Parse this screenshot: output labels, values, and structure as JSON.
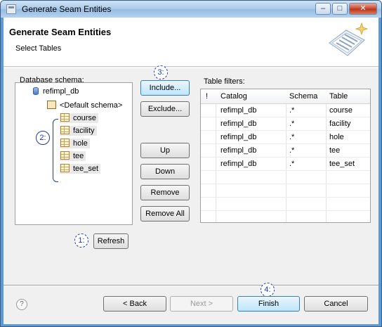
{
  "window": {
    "title": "Generate Seam Entities",
    "controls": {
      "minimize": "–",
      "maximize": "□",
      "close": "✕"
    }
  },
  "header": {
    "title": "Generate Seam Entities",
    "subtitle": "Select Tables"
  },
  "database_schema": {
    "label": "Database schema:",
    "root": "refimpl_db",
    "schema": "<Default schema>",
    "tables": [
      "course",
      "facility",
      "hole",
      "tee",
      "tee_set"
    ]
  },
  "buttons": {
    "include": "Include...",
    "exclude": "Exclude...",
    "up": "Up",
    "down": "Down",
    "remove": "Remove",
    "remove_all": "Remove All",
    "refresh": "Refresh",
    "back": "< Back",
    "next": "Next >",
    "finish": "Finish",
    "cancel": "Cancel"
  },
  "table_filters": {
    "label": "Table filters:",
    "columns": [
      "!",
      "Catalog",
      "Schema",
      "Table"
    ],
    "rows": [
      [
        "",
        "refimpl_db",
        ".*",
        "course"
      ],
      [
        "",
        "refimpl_db",
        ".*",
        "facility"
      ],
      [
        "",
        "refimpl_db",
        ".*",
        "hole"
      ],
      [
        "",
        "refimpl_db",
        ".*",
        "tee"
      ],
      [
        "",
        "refimpl_db",
        ".*",
        "tee_set"
      ]
    ]
  },
  "markers": {
    "m1": "1:",
    "m2": "2:",
    "m3": "3:",
    "m4": "4:"
  },
  "help": "?"
}
